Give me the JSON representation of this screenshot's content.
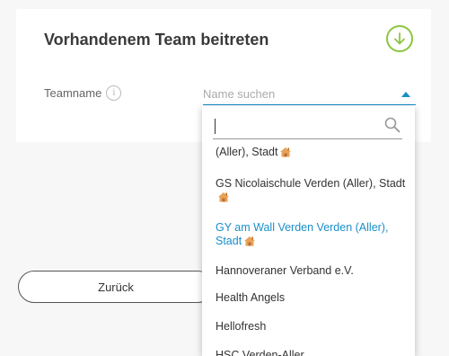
{
  "card": {
    "title": "Vorhandenem Team beitreten",
    "accent_color": "#8cc63f"
  },
  "form": {
    "teamname_label": "Teamname",
    "info_icon_glyph": "i",
    "select_placeholder": "Name suchen"
  },
  "dropdown": {
    "search_value": "",
    "options": [
      {
        "label": "(Aller), Stadt",
        "icon": "house-icon",
        "selected": false
      },
      {
        "label": "GS Nicolaischule Verden (Aller), Stadt",
        "icon": "house-icon",
        "selected": false
      },
      {
        "label": "GY am Wall Verden Verden (Aller), Stadt",
        "icon": "house-icon",
        "selected": true
      },
      {
        "label": "Hannoveraner Verband e.V.",
        "icon": "",
        "selected": false
      },
      {
        "label": "Health Angels",
        "icon": "",
        "selected": false
      },
      {
        "label": "Hellofresh",
        "icon": "",
        "selected": false
      },
      {
        "label": "HSC Verden-Aller",
        "icon": "",
        "selected": false
      }
    ],
    "selected_color": "#1a8fc9"
  },
  "footer": {
    "back_label": "Zurück"
  }
}
